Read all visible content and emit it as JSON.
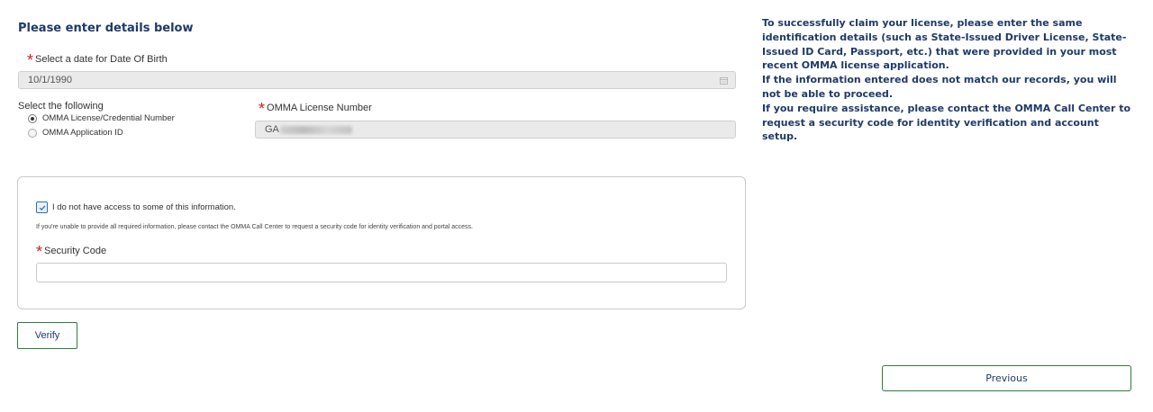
{
  "form": {
    "heading": "Please enter details below",
    "dob": {
      "label": "Select a date for Date Of Birth",
      "value": "10/1/1990",
      "icon": "calendar-icon"
    },
    "id_type": {
      "label": "Select the following",
      "options": [
        {
          "label": "OMMA License/Credential Number",
          "selected": true
        },
        {
          "label": "OMMA Application ID",
          "selected": false
        }
      ]
    },
    "license": {
      "label": "OMMA License Number",
      "value_prefix": "GA"
    }
  },
  "access_card": {
    "checkbox_label": "I do not have access to some of this information.",
    "checked": true,
    "note": "If you're unable to provide all required information, please contact the OMMA Call Center to request a security code for identity verification and portal access.",
    "security_code_label": "Security Code",
    "security_code_value": ""
  },
  "buttons": {
    "verify": "Verify",
    "previous": "Previous"
  },
  "info": {
    "line1": "To successfully claim your license, please enter the same identification details (such as State-Issued Driver License, State-Issued ID Card, Passport, etc.) that were provided in your most recent OMMA license application.",
    "line2": "If the information entered does not match our records, you will not be able to proceed.",
    "line3": "If you require assistance, please contact the OMMA Call Center to request a security code for identity verification and account setup."
  },
  "colors": {
    "accent": "#1f3a68",
    "button_border": "#2e7d3a",
    "required": "#d81e1e",
    "checkbox": "#2a6fbb"
  }
}
